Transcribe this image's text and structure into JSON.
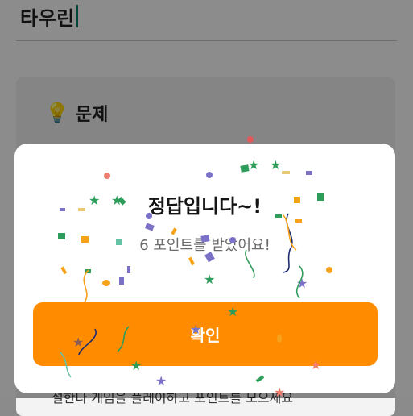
{
  "page": {
    "title": "타우린",
    "question_header": "문제",
    "bulb_icon": "lightbulb-icon",
    "footer_partial": "설한다 게임을 플레이하고 포인트를 모으세요"
  },
  "modal": {
    "title": "정답입니다~!",
    "subtitle": "6 포인트를 받았어요!",
    "confirm_label": "확인",
    "confetti": "confetti-decoration"
  },
  "colors": {
    "accent": "#ff8c00",
    "caret": "#0b7a74",
    "confetti": [
      "#2e9c5a",
      "#f7a21b",
      "#7b72c8",
      "#f07f6f",
      "#1e2a6e",
      "#66c2a5",
      "#e8c872"
    ]
  }
}
